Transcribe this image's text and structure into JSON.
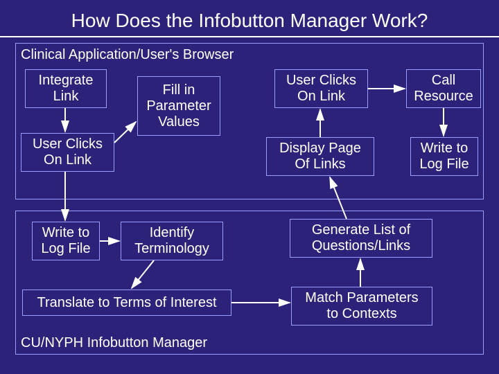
{
  "title": "How Does the Infobutton Manager Work?",
  "frames": {
    "top": {
      "label": "Clinical Application/User's Browser"
    },
    "bottom": {
      "label": "CU/NYPH Infobutton Manager"
    }
  },
  "nodes": {
    "integrate_link": "Integrate\nLink",
    "user_clicks_1": "User Clicks\nOn Link",
    "fill_params": "Fill in\nParameter\nValues",
    "user_clicks_2": "User Clicks\nOn Link",
    "display_page": "Display Page\nOf Links",
    "call_resource": "Call\nResource",
    "write_log_1": "Write to\nLog File",
    "write_log_2": "Write to\nLog File",
    "identify_term": "Identify\nTerminology",
    "translate": "Translate to Terms of Interest",
    "gen_list": "Generate List of\nQuestions/Links",
    "match_params": "Match Parameters\nto Contexts"
  }
}
